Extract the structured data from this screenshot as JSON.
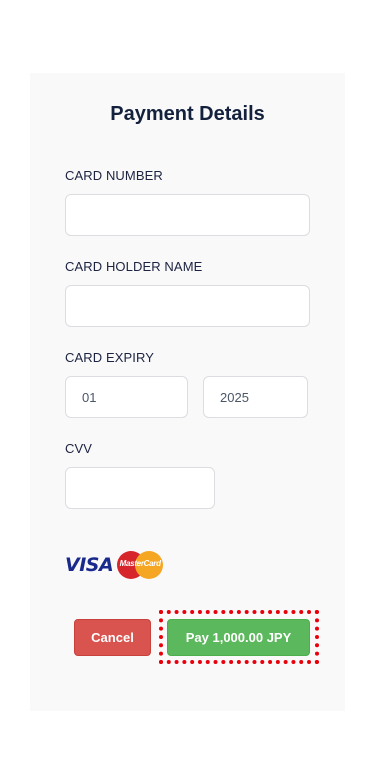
{
  "form": {
    "title": "Payment Details",
    "card_number": {
      "label": "CARD NUMBER",
      "value": ""
    },
    "holder_name": {
      "label": "CARD HOLDER NAME",
      "value": ""
    },
    "expiry": {
      "label": "CARD EXPIRY",
      "month": "01",
      "year": "2025"
    },
    "cvv": {
      "label": "CVV",
      "value": ""
    }
  },
  "logos": {
    "visa": "VISA",
    "mastercard": "MasterCard"
  },
  "actions": {
    "cancel_label": "Cancel",
    "pay_label": "Pay 1,000.00 JPY"
  },
  "colors": {
    "cancel": "#d9534f",
    "pay": "#5cb85c",
    "highlight": "#e8000b"
  }
}
